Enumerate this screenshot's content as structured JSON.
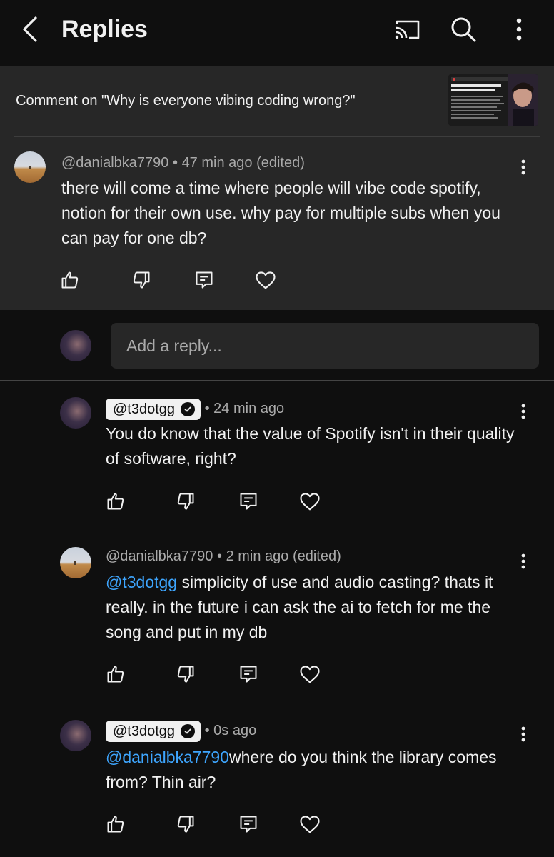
{
  "header": {
    "title": "Replies"
  },
  "video": {
    "title": "Comment on \"Why is everyone vibing coding wrong?\""
  },
  "parent_comment": {
    "author": "@danialbka7790",
    "time": "47 min ago (edited)",
    "text": "there will come a time where people will vibe code spotify, notion for their own use. why pay for multiple subs when you can pay for one db?"
  },
  "reply_box": {
    "placeholder": "Add a reply..."
  },
  "replies": [
    {
      "author": "@t3dotgg",
      "time": "24 min ago",
      "text": "You do know that the value of Spotify isn't in their quality of software, right?"
    },
    {
      "author": "@danialbka7790",
      "time": "2 min ago (edited)",
      "mention": "@t3dotgg",
      "text": " simplicity of use and audio casting? thats it really. in the future i can ask the ai to fetch for me the song and put in my db"
    },
    {
      "author": "@t3dotgg",
      "time": "0s ago",
      "mention": "@danialbka7790",
      "text": "where do you think the library comes from? Thin air?"
    }
  ],
  "separator": "•",
  "icons": {
    "back": "chevron-left-icon",
    "cast": "cast-icon",
    "search": "search-icon",
    "more": "more-vertical-icon",
    "like": "thumbs-up-icon",
    "dislike": "thumbs-down-icon",
    "reply": "comment-icon",
    "heart": "heart-icon",
    "verified": "verified-check-icon"
  },
  "colors": {
    "background": "#0f0f0f",
    "panel": "#272727",
    "text": "#f1f1f1",
    "secondary_text": "#aaaaaa",
    "mention": "#3ea6ff"
  }
}
